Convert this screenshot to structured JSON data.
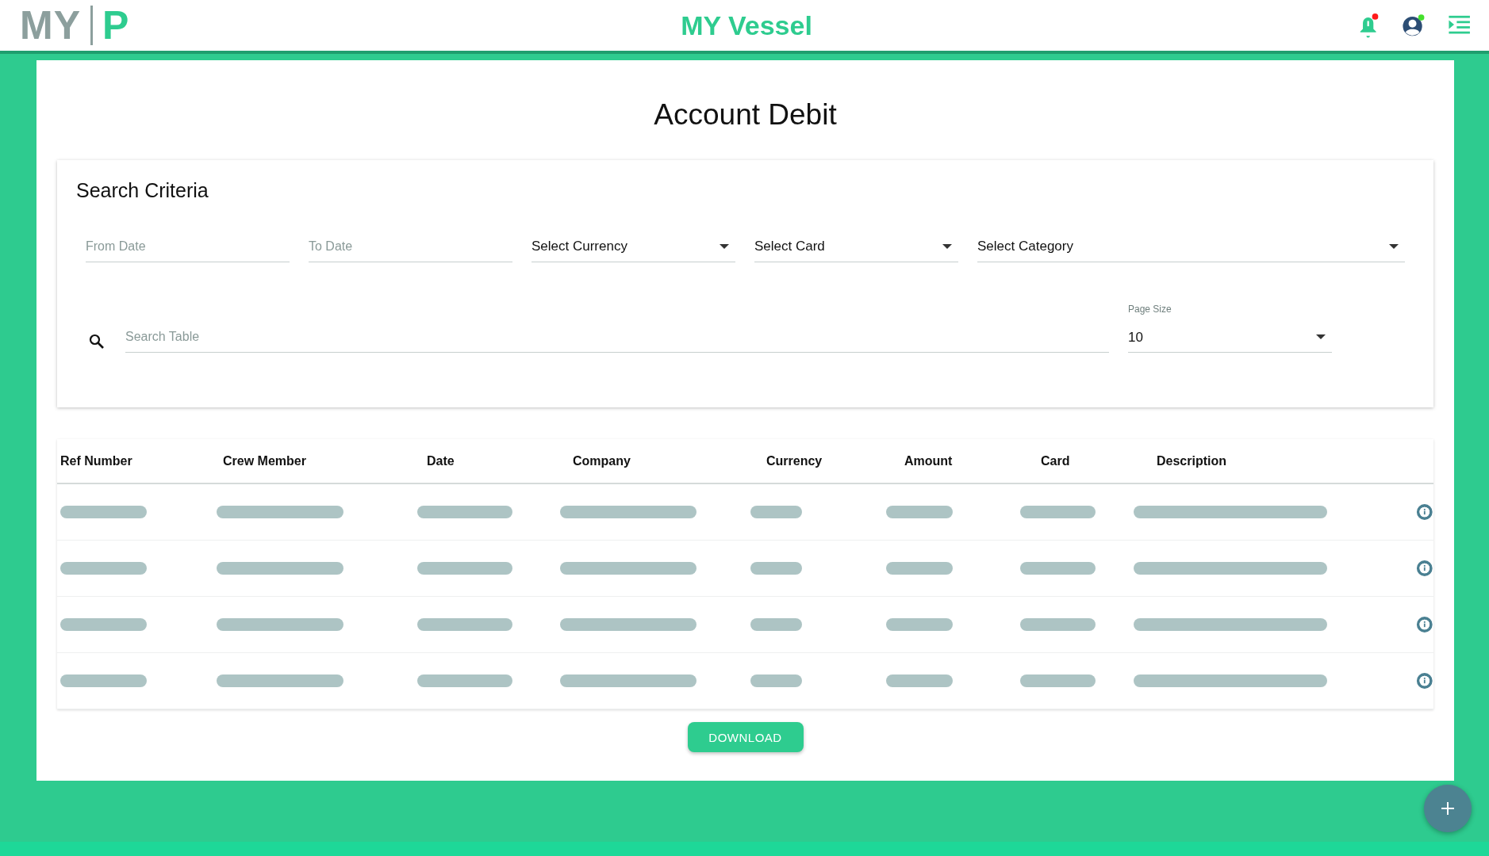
{
  "header": {
    "logo_left": "MY",
    "logo_right": "P",
    "title": "MY Vessel",
    "notification_badge": true,
    "profile_online": true
  },
  "page_title": "Account Debit",
  "search_criteria": {
    "title": "Search Criteria",
    "filters": [
      {
        "kind": "date",
        "placeholder": "From Date"
      },
      {
        "kind": "date",
        "placeholder": "To Date"
      },
      {
        "kind": "select",
        "value": "Select Currency"
      },
      {
        "kind": "select",
        "value": "Select Card"
      },
      {
        "kind": "select",
        "value": "Select Category"
      }
    ],
    "search": {
      "placeholder": "Search Table"
    },
    "page_size": {
      "label": "Page Size",
      "value": "10"
    }
  },
  "table": {
    "columns": [
      "Ref Number",
      "Crew Member",
      "Date",
      "Company",
      "Currency",
      "Amount",
      "Card",
      "Description"
    ],
    "rows": [
      {
        "kind": "loading"
      },
      {
        "kind": "loading"
      },
      {
        "kind": "loading"
      },
      {
        "kind": "loading"
      }
    ]
  },
  "download_button": "DOWNLOAD"
}
